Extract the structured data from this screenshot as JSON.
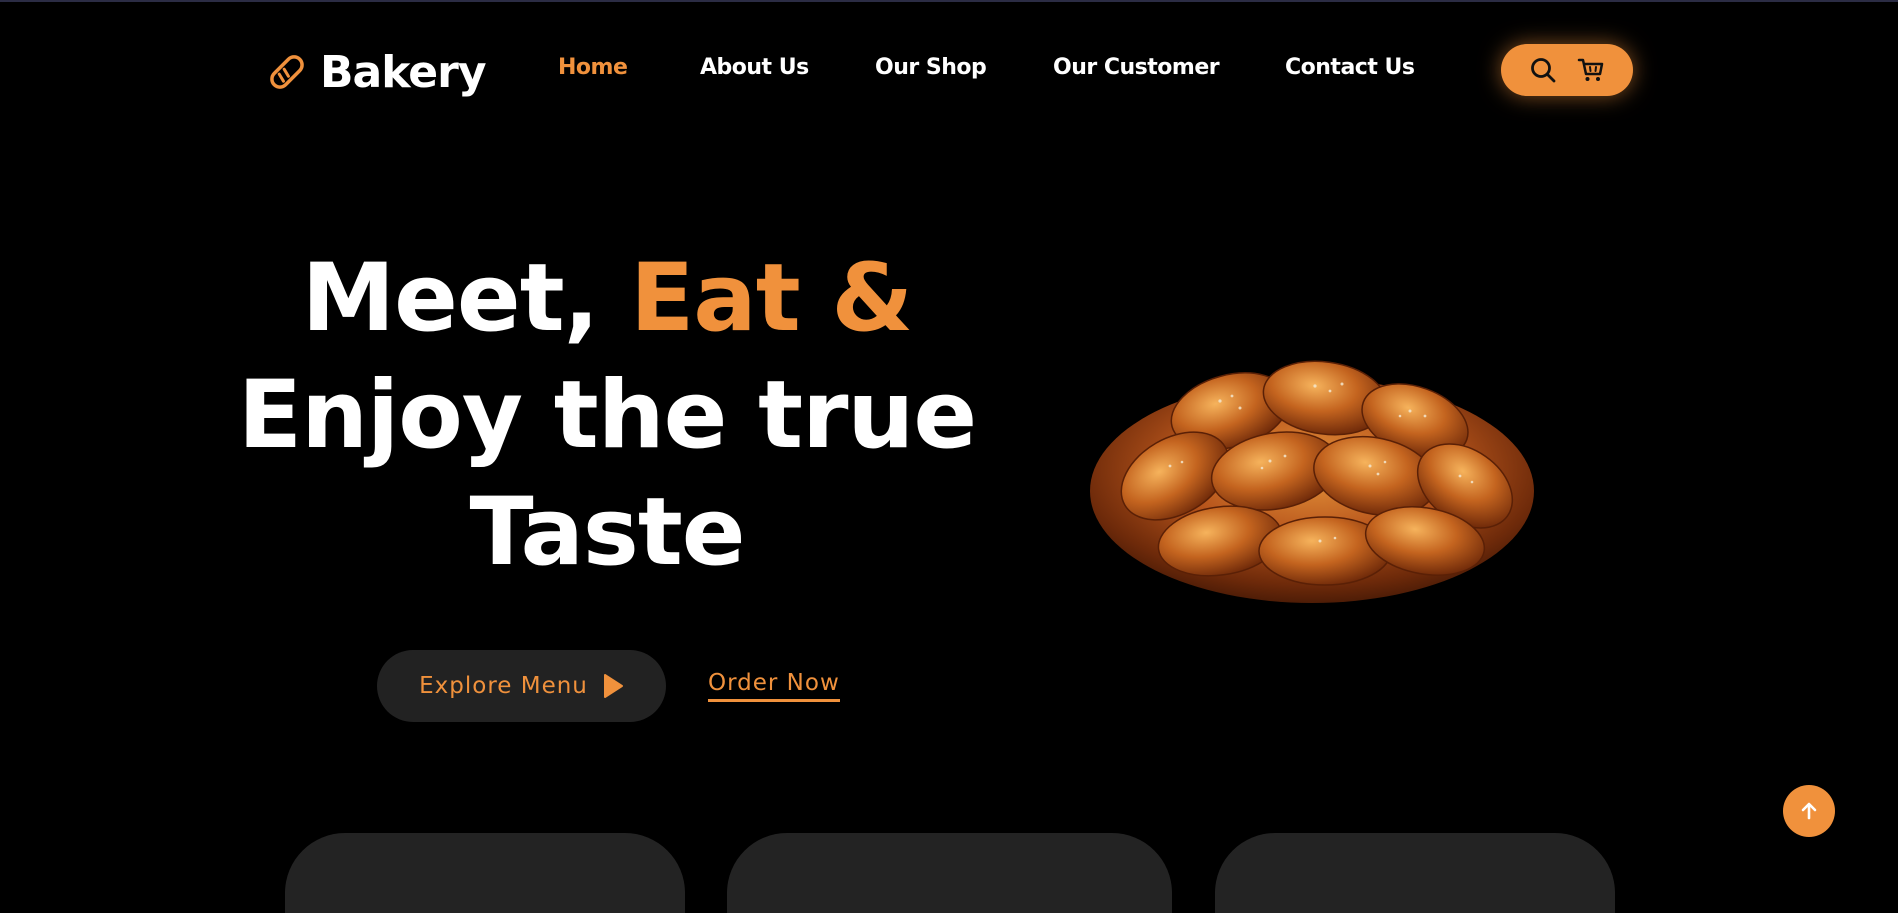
{
  "brand": {
    "name": "Bakery",
    "icon": "bread-loaf-icon",
    "accent_color": "#f0913c"
  },
  "nav": {
    "items": [
      {
        "label": "Home",
        "active": true
      },
      {
        "label": "About Us",
        "active": false
      },
      {
        "label": "Our Shop",
        "active": false
      },
      {
        "label": "Our Customer",
        "active": false
      },
      {
        "label": "Contact Us",
        "active": false
      }
    ],
    "actions": {
      "search_icon": "search-icon",
      "cart_icon": "cart-icon"
    }
  },
  "hero": {
    "line1_white": "Meet, ",
    "line1_accent": "Eat &",
    "line2": "Enjoy the true",
    "line3": "Taste",
    "explore_label": "Explore Menu",
    "explore_icon": "play-icon",
    "order_label": "Order Now",
    "image": "braided-bread-image"
  },
  "scroll_top": {
    "icon": "arrow-up-icon"
  },
  "colors": {
    "background": "#000000",
    "accent": "#f0913c",
    "button_dark": "#222222",
    "card": "#232323"
  }
}
